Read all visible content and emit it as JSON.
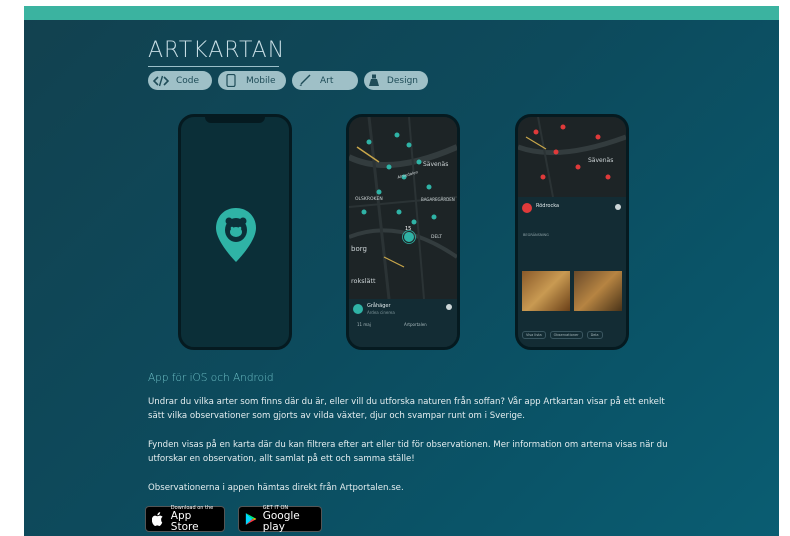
{
  "header": {
    "title": "ARTKARTAN",
    "tags": [
      {
        "label": "Code",
        "icon": "code-icon"
      },
      {
        "label": "Mobile",
        "icon": "mobile-icon"
      },
      {
        "label": "Art",
        "icon": "brush-icon"
      },
      {
        "label": "Design",
        "icon": "design-icon"
      }
    ]
  },
  "phones": {
    "map_labels": {
      "savenas": "Sävenäs",
      "almedalen": "Almedalen",
      "olskroken": "OLSKROKEN",
      "bagaregarden": "BAGAREGÅRDEN",
      "gbg": "borg",
      "delt": "DELT",
      "rokslatt": "rokslätt",
      "cluster_count": "15"
    },
    "phone2_card": {
      "name": "Gråhäger",
      "sub": "Ardea cinerea",
      "meta1": "11 maj",
      "meta2": "Artportalen"
    },
    "phone3_card": {
      "name": "Rödrocka",
      "section": "BEGRÄNSNING",
      "tags": [
        "Visa lista",
        "Observationer",
        "Dela"
      ]
    }
  },
  "content": {
    "heading": "App för iOS och Android",
    "p1_line1": "Undrar du vilka arter som finns där du är, eller vill du utforska naturen från soffan? Vår app Artkartan visar på ett enkelt",
    "p1_line2": "sätt vilka observationer som gjorts av vilda växter, djur och svampar runt om i Sverige.",
    "p2_line1": "Fynden visas på en karta där du kan filtrera efter art eller tid för observationen. Mer information om arterna visas när du",
    "p2_line2": "utforskar en observation, allt samlat på ett och samma ställe!",
    "p3_line1": "Observationerna i appen hämtas direkt från Artportalen.se."
  },
  "badges": {
    "apple_small": "Download on the",
    "apple_big": "App Store",
    "google_small": "GET IT ON",
    "google_big": "Google play"
  },
  "colors": {
    "accent": "#3bb3a0",
    "background": "#0d4a5c",
    "tag_bg": "#9fc0c7",
    "heading": "#6fc1c7",
    "observation_dot": "#2fb3a6",
    "red_dot": "#e03a3a"
  }
}
